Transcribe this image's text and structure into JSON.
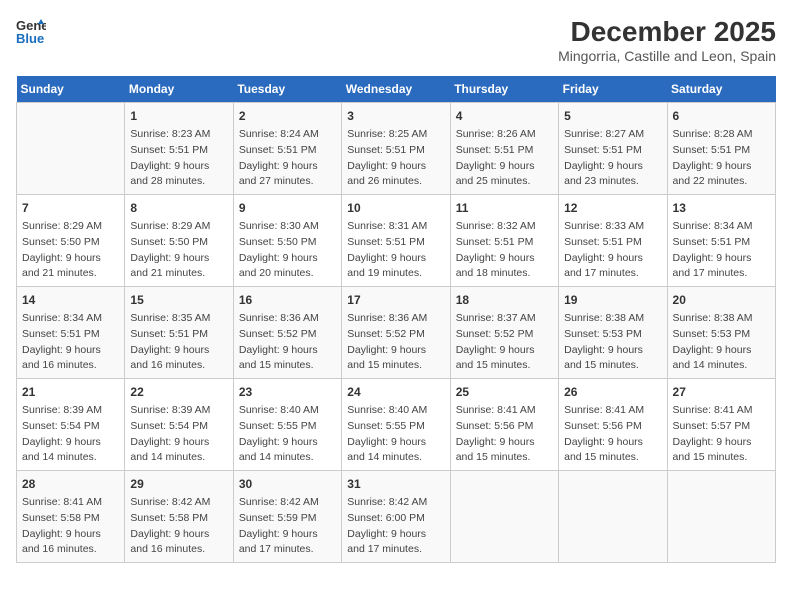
{
  "header": {
    "logo_line1": "General",
    "logo_line2": "Blue",
    "title": "December 2025",
    "subtitle": "Mingorria, Castille and Leon, Spain"
  },
  "days_of_week": [
    "Sunday",
    "Monday",
    "Tuesday",
    "Wednesday",
    "Thursday",
    "Friday",
    "Saturday"
  ],
  "weeks": [
    [
      {
        "day": "",
        "content": ""
      },
      {
        "day": "1",
        "content": "Sunrise: 8:23 AM\nSunset: 5:51 PM\nDaylight: 9 hours\nand 28 minutes."
      },
      {
        "day": "2",
        "content": "Sunrise: 8:24 AM\nSunset: 5:51 PM\nDaylight: 9 hours\nand 27 minutes."
      },
      {
        "day": "3",
        "content": "Sunrise: 8:25 AM\nSunset: 5:51 PM\nDaylight: 9 hours\nand 26 minutes."
      },
      {
        "day": "4",
        "content": "Sunrise: 8:26 AM\nSunset: 5:51 PM\nDaylight: 9 hours\nand 25 minutes."
      },
      {
        "day": "5",
        "content": "Sunrise: 8:27 AM\nSunset: 5:51 PM\nDaylight: 9 hours\nand 23 minutes."
      },
      {
        "day": "6",
        "content": "Sunrise: 8:28 AM\nSunset: 5:51 PM\nDaylight: 9 hours\nand 22 minutes."
      }
    ],
    [
      {
        "day": "7",
        "content": "Sunrise: 8:29 AM\nSunset: 5:50 PM\nDaylight: 9 hours\nand 21 minutes."
      },
      {
        "day": "8",
        "content": "Sunrise: 8:29 AM\nSunset: 5:50 PM\nDaylight: 9 hours\nand 21 minutes."
      },
      {
        "day": "9",
        "content": "Sunrise: 8:30 AM\nSunset: 5:50 PM\nDaylight: 9 hours\nand 20 minutes."
      },
      {
        "day": "10",
        "content": "Sunrise: 8:31 AM\nSunset: 5:51 PM\nDaylight: 9 hours\nand 19 minutes."
      },
      {
        "day": "11",
        "content": "Sunrise: 8:32 AM\nSunset: 5:51 PM\nDaylight: 9 hours\nand 18 minutes."
      },
      {
        "day": "12",
        "content": "Sunrise: 8:33 AM\nSunset: 5:51 PM\nDaylight: 9 hours\nand 17 minutes."
      },
      {
        "day": "13",
        "content": "Sunrise: 8:34 AM\nSunset: 5:51 PM\nDaylight: 9 hours\nand 17 minutes."
      }
    ],
    [
      {
        "day": "14",
        "content": "Sunrise: 8:34 AM\nSunset: 5:51 PM\nDaylight: 9 hours\nand 16 minutes."
      },
      {
        "day": "15",
        "content": "Sunrise: 8:35 AM\nSunset: 5:51 PM\nDaylight: 9 hours\nand 16 minutes."
      },
      {
        "day": "16",
        "content": "Sunrise: 8:36 AM\nSunset: 5:52 PM\nDaylight: 9 hours\nand 15 minutes."
      },
      {
        "day": "17",
        "content": "Sunrise: 8:36 AM\nSunset: 5:52 PM\nDaylight: 9 hours\nand 15 minutes."
      },
      {
        "day": "18",
        "content": "Sunrise: 8:37 AM\nSunset: 5:52 PM\nDaylight: 9 hours\nand 15 minutes."
      },
      {
        "day": "19",
        "content": "Sunrise: 8:38 AM\nSunset: 5:53 PM\nDaylight: 9 hours\nand 15 minutes."
      },
      {
        "day": "20",
        "content": "Sunrise: 8:38 AM\nSunset: 5:53 PM\nDaylight: 9 hours\nand 14 minutes."
      }
    ],
    [
      {
        "day": "21",
        "content": "Sunrise: 8:39 AM\nSunset: 5:54 PM\nDaylight: 9 hours\nand 14 minutes."
      },
      {
        "day": "22",
        "content": "Sunrise: 8:39 AM\nSunset: 5:54 PM\nDaylight: 9 hours\nand 14 minutes."
      },
      {
        "day": "23",
        "content": "Sunrise: 8:40 AM\nSunset: 5:55 PM\nDaylight: 9 hours\nand 14 minutes."
      },
      {
        "day": "24",
        "content": "Sunrise: 8:40 AM\nSunset: 5:55 PM\nDaylight: 9 hours\nand 14 minutes."
      },
      {
        "day": "25",
        "content": "Sunrise: 8:41 AM\nSunset: 5:56 PM\nDaylight: 9 hours\nand 15 minutes."
      },
      {
        "day": "26",
        "content": "Sunrise: 8:41 AM\nSunset: 5:56 PM\nDaylight: 9 hours\nand 15 minutes."
      },
      {
        "day": "27",
        "content": "Sunrise: 8:41 AM\nSunset: 5:57 PM\nDaylight: 9 hours\nand 15 minutes."
      }
    ],
    [
      {
        "day": "28",
        "content": "Sunrise: 8:41 AM\nSunset: 5:58 PM\nDaylight: 9 hours\nand 16 minutes."
      },
      {
        "day": "29",
        "content": "Sunrise: 8:42 AM\nSunset: 5:58 PM\nDaylight: 9 hours\nand 16 minutes."
      },
      {
        "day": "30",
        "content": "Sunrise: 8:42 AM\nSunset: 5:59 PM\nDaylight: 9 hours\nand 17 minutes."
      },
      {
        "day": "31",
        "content": "Sunrise: 8:42 AM\nSunset: 6:00 PM\nDaylight: 9 hours\nand 17 minutes."
      },
      {
        "day": "",
        "content": ""
      },
      {
        "day": "",
        "content": ""
      },
      {
        "day": "",
        "content": ""
      }
    ]
  ]
}
